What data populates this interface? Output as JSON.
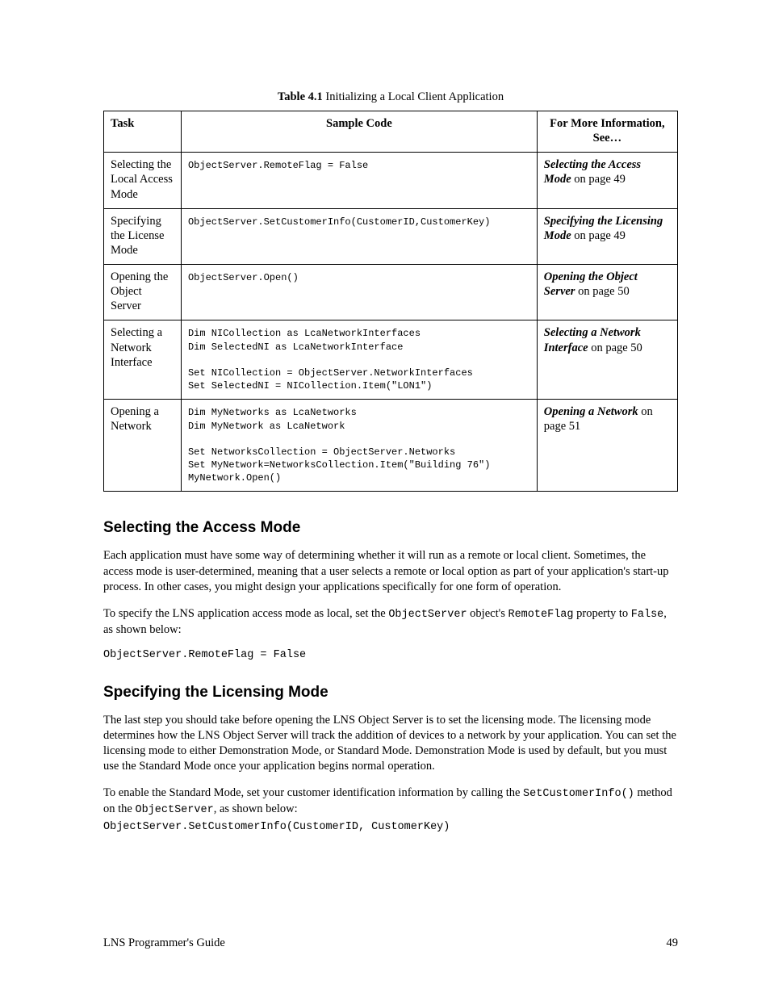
{
  "table": {
    "caption_label": "Table 4.1",
    "caption_text": "Initializing a Local Client Application",
    "headers": {
      "task": "Task",
      "code": "Sample Code",
      "info": "For More Information, See…"
    },
    "rows": [
      {
        "task": "Selecting the Local Access Mode",
        "code": "ObjectServer.RemoteFlag = False",
        "info_italic": "Selecting the Access Mode",
        "info_rest": " on page 49"
      },
      {
        "task": "Specifying the License Mode",
        "code": "ObjectServer.SetCustomerInfo(CustomerID,CustomerKey)",
        "info_italic": "Specifying the Licensing Mode",
        "info_rest": " on page 49"
      },
      {
        "task": "Opening the Object Server",
        "code": "ObjectServer.Open()",
        "info_italic": "Opening the Object Server",
        "info_rest": " on page 50"
      },
      {
        "task": "Selecting a Network Interface",
        "code": "Dim NICollection as LcaNetworkInterfaces\nDim SelectedNI as LcaNetworkInterface\n\nSet NICollection = ObjectServer.NetworkInterfaces\nSet SelectedNI = NICollection.Item(\"LON1\")",
        "info_italic": "Selecting a Network Interface",
        "info_rest": " on page 50"
      },
      {
        "task": "Opening a Network",
        "code": "Dim MyNetworks as LcaNetworks\nDim MyNetwork as LcaNetwork\n\nSet NetworksCollection = ObjectServer.Networks\nSet MyNetwork=NetworksCollection.Item(\"Building 76\")\nMyNetwork.Open()",
        "info_italic": "Opening a Network",
        "info_rest": " on page 51"
      }
    ]
  },
  "section1": {
    "heading": "Selecting the Access Mode",
    "p1": "Each application must have some way of determining whether it will run as a remote or local client. Sometimes, the access mode is user-determined, meaning that a user selects a remote or local option as part of your application's start-up process. In other cases, you might design your applications specifically for one form of operation.",
    "p2_a": "To specify the LNS application access mode as local, set the ",
    "p2_code1": "ObjectServer",
    "p2_b": " object's ",
    "p2_code2": "RemoteFlag",
    "p2_c": " property to ",
    "p2_code3": "False",
    "p2_d": ", as shown below:",
    "codeblock": "ObjectServer.RemoteFlag = False"
  },
  "section2": {
    "heading": "Specifying the Licensing Mode",
    "p1": "The last step you should take before opening the LNS Object Server is to set the licensing mode. The licensing mode determines how the LNS Object Server will track the addition of devices to a network by your application. You can set the licensing mode to either Demonstration Mode, or Standard Mode. Demonstration Mode is used by default, but you must use the Standard Mode once your application begins normal operation.",
    "p2_a": "To enable the Standard Mode, set your customer identification information by   calling the ",
    "p2_code1": "SetCustomerInfo()",
    "p2_b": " method on the ",
    "p2_code2": "ObjectServer",
    "p2_c": ", as shown below:",
    "codeblock": "ObjectServer.SetCustomerInfo(CustomerID, CustomerKey)"
  },
  "footer": {
    "title": "LNS Programmer's Guide",
    "page": "49"
  }
}
